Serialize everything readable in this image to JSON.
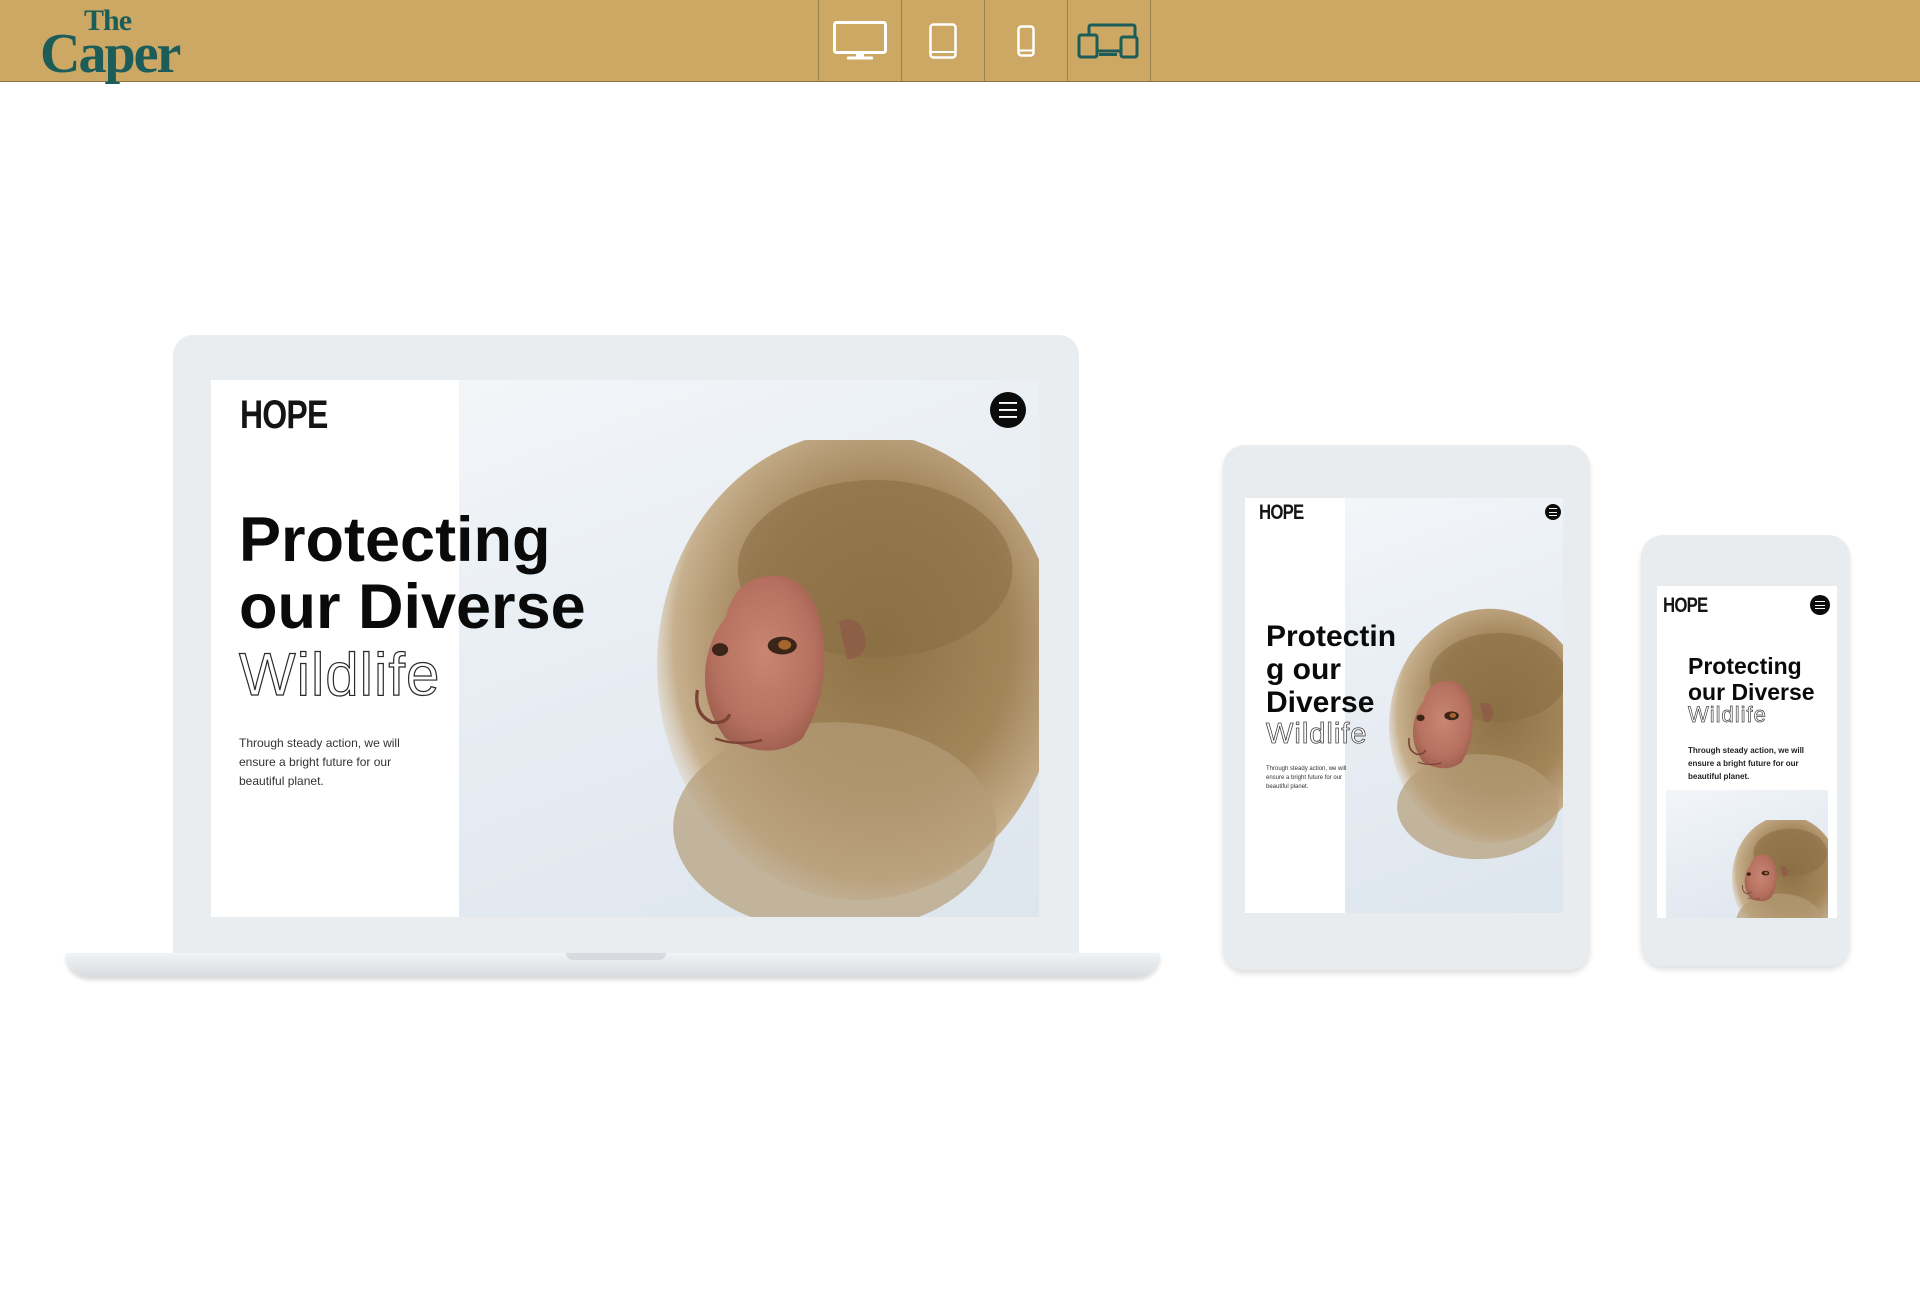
{
  "app": {
    "brand_small": "The",
    "brand_large": "Caper"
  },
  "toolbar": {
    "devices": [
      {
        "name": "desktop",
        "icon": "desktop-icon"
      },
      {
        "name": "tablet",
        "icon": "tablet-icon"
      },
      {
        "name": "phone",
        "icon": "phone-icon"
      },
      {
        "name": "all-devices",
        "icon": "multi-device-icon"
      }
    ]
  },
  "site": {
    "logo": "HOPE",
    "headline_line1": "Protecting",
    "headline_line2": "our Diverse",
    "headline_outline": "Wildlife",
    "tablet_line1": "Protectin",
    "tablet_line2": "g our",
    "tablet_line3": "Diverse",
    "body_line1": "Through steady action, we will",
    "body_line2": "ensure a bright future for our",
    "body_line3": "beautiful planet.",
    "body_full": "Through steady action, we will ensure a bright future for our beautiful planet."
  },
  "colors": {
    "topbar": "#cca864",
    "brand": "#1c5c59",
    "device_icon": "#1c5c59",
    "device_icon_active": "#ffffff"
  }
}
